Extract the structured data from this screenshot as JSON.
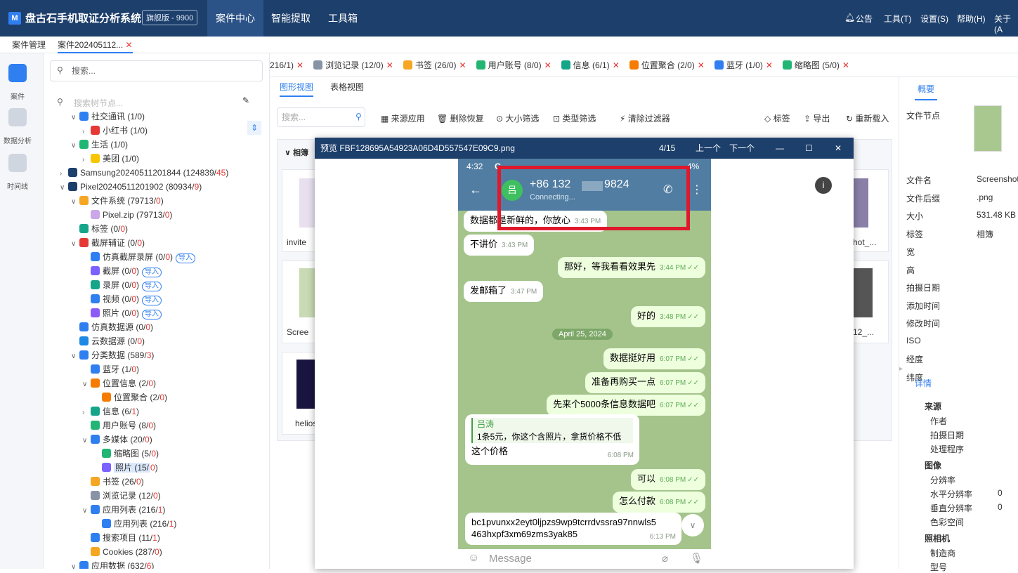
{
  "app": {
    "logo": "M",
    "title": "盘古石手机取证分析系统",
    "edition": "旗舰版 - 9900",
    "menu": [
      "案件中心",
      "智能提取",
      "工具箱"
    ],
    "right_menu": [
      "公告",
      "工具(T)",
      "设置(S)",
      "帮助(H)",
      "关于(A"
    ]
  },
  "tabs": {
    "case_mgmt": "案件管理",
    "case_tab": "案件202405112...",
    "close": "✕"
  },
  "iconbar": {
    "case": "案件",
    "analysis": "数据分析",
    "timeline": "时间线"
  },
  "tree": {
    "search_placeholder": "搜索...",
    "node_placeholder": "搜索树节点...",
    "nodes": [
      {
        "indent": 1,
        "arrow": "∨",
        "icon": "#2f7ff0",
        "text": "社交通讯 (1/0)"
      },
      {
        "indent": 2,
        "arrow": "›",
        "icon": "#e53935",
        "text": "小红书 (1/0)"
      },
      {
        "indent": 1,
        "arrow": "∨",
        "icon": "#22b573",
        "text": "生活 (1/0)"
      },
      {
        "indent": 2,
        "arrow": "›",
        "icon": "#f7c600",
        "text": "美团 (1/0)"
      },
      {
        "indent": 0,
        "arrow": "›",
        "icon": "#1d3f6b",
        "text": "Samsung20240511201844 (124839/",
        "red": "45",
        ")": ")"
      },
      {
        "indent": 0,
        "arrow": "∨",
        "icon": "#1d3f6b",
        "text": "Pixel20240511201902 (80934/",
        "red": "9",
        ")": ")"
      },
      {
        "indent": 1,
        "arrow": "∨",
        "icon": "#f5a623",
        "text": "文件系统 (79713/",
        "red": "0",
        ")": ")"
      },
      {
        "indent": 2,
        "arrow": "",
        "icon": "#c9a7e8",
        "text": "Pixel.zip (79713/",
        "red": "0",
        ")": ")"
      },
      {
        "indent": 1,
        "arrow": "",
        "icon": "#15a589",
        "text": "标签 (0/",
        "red": "0",
        ")": ")"
      },
      {
        "indent": 1,
        "arrow": "∨",
        "icon": "#e53935",
        "text": "截屏辅证 (0/",
        "red": "0",
        ")": ")"
      },
      {
        "indent": 2,
        "arrow": "",
        "icon": "#2f7ff0",
        "text": "仿真截屏录屏 (0/",
        "red": "0",
        ")": ")",
        "imp": "导入"
      },
      {
        "indent": 2,
        "arrow": "",
        "icon": "#7b61ff",
        "text": "截屏 (0/",
        "red": "0",
        ")": ")",
        "imp": "导入"
      },
      {
        "indent": 2,
        "arrow": "",
        "icon": "#15a589",
        "text": "录屏 (0/",
        "red": "0",
        ")": ")",
        "imp": "导入"
      },
      {
        "indent": 2,
        "arrow": "",
        "icon": "#2f7ff0",
        "text": "视频 (0/",
        "red": "0",
        ")": ")",
        "imp": "导入"
      },
      {
        "indent": 2,
        "arrow": "",
        "icon": "#8b5cf6",
        "text": "照片 (0/",
        "red": "0",
        ")": ")",
        "imp": "导入"
      },
      {
        "indent": 1,
        "arrow": "",
        "icon": "#2f7ff0",
        "text": "仿真数据源 (0/",
        "red": "0",
        ")": ")"
      },
      {
        "indent": 1,
        "arrow": "",
        "icon": "#1e88e5",
        "text": "云数据源 (0/",
        "red": "0",
        ")": ")"
      },
      {
        "indent": 1,
        "arrow": "∨",
        "icon": "#2f7ff0",
        "text": "分类数据 (589/",
        "red": "3",
        ")": ")"
      },
      {
        "indent": 2,
        "arrow": "",
        "icon": "#2f7ff0",
        "text": "蓝牙 (1/",
        "red": "0",
        ")": ")"
      },
      {
        "indent": 2,
        "arrow": "∨",
        "icon": "#f57c00",
        "text": "位置信息 (2/",
        "red": "0",
        ")": ")"
      },
      {
        "indent": 3,
        "arrow": "",
        "icon": "#f57c00",
        "text": "位置聚合 (2/",
        "red": "0",
        ")": ")"
      },
      {
        "indent": 2,
        "arrow": "›",
        "icon": "#15a589",
        "text": "信息 (6/",
        "red": "1",
        ")": ")"
      },
      {
        "indent": 2,
        "arrow": "",
        "icon": "#22b573",
        "text": "用户账号 (8/",
        "red": "0",
        ")": ")"
      },
      {
        "indent": 2,
        "arrow": "∨",
        "icon": "#2f7ff0",
        "text": "多媒体 (20/",
        "red": "0",
        ")": ")"
      },
      {
        "indent": 3,
        "arrow": "",
        "icon": "#22b573",
        "text": "缩略图 (5/",
        "red": "0",
        ")": ")"
      },
      {
        "indent": 3,
        "arrow": "",
        "icon": "#7b61ff",
        "text": "照片 (15/",
        "red": "0",
        ")": ")",
        "sel": true
      },
      {
        "indent": 2,
        "arrow": "",
        "icon": "#f5a623",
        "text": "书签 (26/",
        "red": "0",
        ")": ")"
      },
      {
        "indent": 2,
        "arrow": "",
        "icon": "#8894a6",
        "text": "浏览记录 (12/",
        "red": "0",
        ")": ")"
      },
      {
        "indent": 2,
        "arrow": "∨",
        "icon": "#2f7ff0",
        "text": "应用列表 (216/",
        "red": "1",
        ")": ")"
      },
      {
        "indent": 3,
        "arrow": "",
        "icon": "#2f7ff0",
        "text": "应用列表 (216/",
        "red": "1",
        ")": ")"
      },
      {
        "indent": 2,
        "arrow": "",
        "icon": "#2f7ff0",
        "text": "搜索项目 (11/",
        "red": "1",
        ")": ")"
      },
      {
        "indent": 2,
        "arrow": "",
        "icon": "#f5a623",
        "text": "Cookies (287/",
        "red": "0",
        ")": ")"
      },
      {
        "indent": 1,
        "arrow": "∨",
        "icon": "#2f7ff0",
        "text": "应用数据 (632/",
        "red": "6",
        ")": ")"
      }
    ]
  },
  "maintabs": [
    {
      "icon": "",
      "label": "216/1)"
    },
    {
      "icon": "#8894a6",
      "label": "浏览记录 (12/0)"
    },
    {
      "icon": "#f5a623",
      "label": "书签 (26/0)"
    },
    {
      "icon": "#22b573",
      "label": "用户账号 (8/0)"
    },
    {
      "icon": "#15a589",
      "label": "信息 (6/1)"
    },
    {
      "icon": "#f57c00",
      "label": "位置聚合 (2/0)"
    },
    {
      "icon": "#2f7ff0",
      "label": "蓝牙 (1/0)"
    },
    {
      "icon": "#22b573",
      "label": "缩略图 (5/0)"
    }
  ],
  "views": {
    "graph": "图形视图",
    "table": "表格视图"
  },
  "toolbar": {
    "search": "搜索...",
    "source": "来源应用",
    "deleted": "删除恢复",
    "size": "大小筛选",
    "type": "类型筛选",
    "clear": "清除过滤器",
    "tag": "标签",
    "export": "导出",
    "reload": "重新载入"
  },
  "grid": {
    "group": "相簿",
    "labels": [
      "invite",
      "hot_...",
      "Scree",
      "12_...",
      "helios"
    ]
  },
  "preview": {
    "title": "预览 FBF128695A54923A06D4D557547E09C9.png",
    "counter": "4/15",
    "prev": "上一个",
    "next": "下一个"
  },
  "phone": {
    "time": "4:32",
    "status_icons": "G",
    "battery": "4%",
    "contact": "+86 132",
    "contact_tail": "9824",
    "avatar": "吕",
    "connecting": "Connecting...",
    "messages": [
      {
        "side": "l",
        "text": "数据都是新鲜的，你放心",
        "time": "3:43 PM"
      },
      {
        "side": "l",
        "text": "不讲价",
        "time": "3:43 PM"
      },
      {
        "side": "r",
        "text": "那好，等我看看效果先",
        "time": "3:44 PM"
      },
      {
        "side": "l",
        "text": "发邮箱了",
        "time": "3:47 PM"
      },
      {
        "side": "r",
        "text": "好的",
        "time": "3:48 PM"
      },
      {
        "side": "r",
        "text": "数据挺好用",
        "time": "6:07 PM"
      },
      {
        "side": "r",
        "text": "准备再购买一点",
        "time": "6:07 PM"
      },
      {
        "side": "r",
        "text": "先来个5000条信息数据吧",
        "time": "6:07 PM"
      },
      {
        "side": "r",
        "text": "可以",
        "time": "6:08 PM"
      },
      {
        "side": "r",
        "text": "怎么付款",
        "time": "6:08 PM"
      }
    ],
    "date_sep": "April 25, 2024",
    "reply": {
      "name": "吕涛",
      "quote": "1条5元，你这个含照片，拿货价格不低",
      "text": "这个价格",
      "time": "6:08 PM"
    },
    "address": {
      "line1": "bc1pvunxx2eyt0ljpzs9wp9tcrrdvssra97nnwls5",
      "line2": "463hxpf3xm69zms3yak85",
      "time": "6:13 PM"
    },
    "input": "Message"
  },
  "rightpanel": {
    "tab": "概要",
    "file_node": "文件节点",
    "props": [
      {
        "k": "文件名",
        "v": "Screenshot"
      },
      {
        "k": "文件后缀",
        "v": ".png"
      },
      {
        "k": "大小",
        "v": "531.48 KB"
      },
      {
        "k": "标签",
        "v": "相簿"
      },
      {
        "k": "宽",
        "v": ""
      },
      {
        "k": "高",
        "v": ""
      },
      {
        "k": "拍摄日期",
        "v": ""
      },
      {
        "k": "添加时间",
        "v": ""
      },
      {
        "k": "修改时间",
        "v": ""
      },
      {
        "k": "ISO",
        "v": ""
      },
      {
        "k": "经度",
        "v": ""
      },
      {
        "k": "纬度",
        "v": ""
      }
    ],
    "details": "详情",
    "detail_groups": [
      {
        "title": "来源",
        "items": [
          "作者",
          "拍摄日期",
          "处理程序"
        ]
      },
      {
        "title": "图像",
        "items": [
          "分辨率",
          "水平分辨率",
          "垂直分辨率",
          "色彩空间"
        ],
        "vals": [
          "",
          "0",
          "0",
          ""
        ]
      },
      {
        "title": "照相机",
        "items": [
          "制造商",
          "型号"
        ]
      }
    ]
  }
}
